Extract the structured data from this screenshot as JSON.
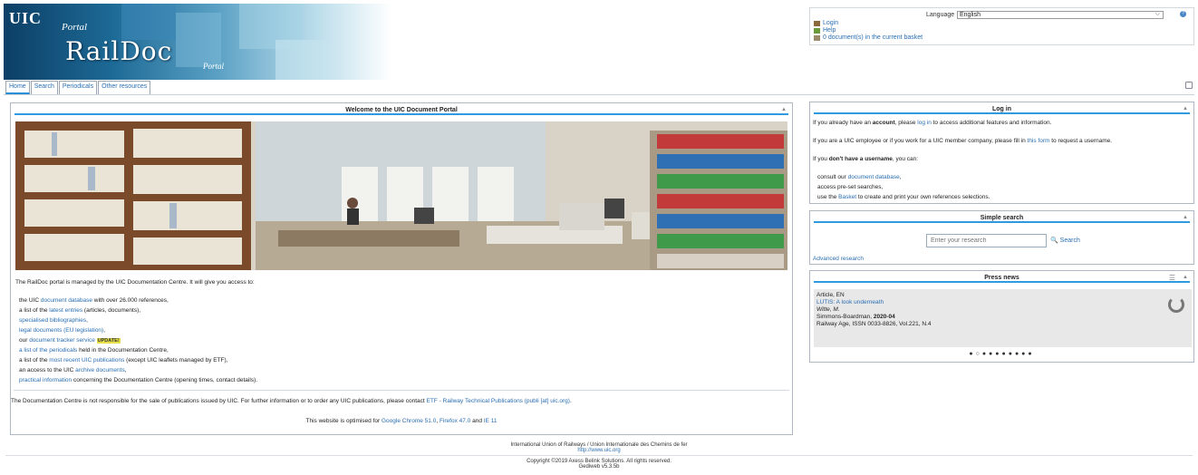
{
  "header": {
    "logo_uic": "UIC",
    "logo_portal": "Portal",
    "logo_raildoc": "RailDoc",
    "logo_portal2": "Portal"
  },
  "tabs": [
    {
      "label": "Home",
      "active": true
    },
    {
      "label": "Search"
    },
    {
      "label": "Periodicals"
    },
    {
      "label": "Other resources"
    }
  ],
  "topbox": {
    "language_label": "Language",
    "language_value": "English",
    "login": "Login",
    "help": "Help",
    "basket": "0 document(s) in the current basket"
  },
  "welcome": {
    "title": "Welcome to the UIC Document Portal",
    "intro": "The RailDoc portal is managed by the UIC Documentation Centre. It will give you access to:",
    "items": [
      {
        "pre": "the UIC ",
        "link": "document database",
        "post": " with over 26.000 references,"
      },
      {
        "pre": "a list of the ",
        "link": "latest entries",
        "post": " (articles, documents),"
      },
      {
        "pre": "",
        "link": "specialised bibliographies",
        "post": ","
      },
      {
        "pre": "",
        "link": "legal documents (EU legislation)",
        "post": ","
      },
      {
        "pre": "our ",
        "link": "document tracker service",
        "post": " ",
        "badge": "UPDATE!"
      },
      {
        "pre": "",
        "link": "a list of the periodicals",
        "post": " held in the Documentation Centre,"
      },
      {
        "pre": "a list of the ",
        "link": "most recent UIC publications",
        "post": " (except UIC leaflets managed by ETF),"
      },
      {
        "pre": "an access to the UIC ",
        "link": "archive documents",
        "post": ","
      },
      {
        "pre": "",
        "link": "practical information",
        "post": " concerning the Documentation Centre (opening times, contact details)."
      }
    ],
    "disclaimer_pre": "The Documentation Centre is not responsible for the sale of publications issued by UIC. For further information or to order any UIC publications, please contact ",
    "disclaimer_link": "ETF - Railway Technical Publications (publi [at] uic.org)",
    "disclaimer_post": ".",
    "optimised_pre": "This website is optimised for ",
    "browser1": "Google Chrome 51.0",
    "sep": ", ",
    "browser2": "Firefox 47.0",
    "and": " and ",
    "browser3": "IE 11"
  },
  "login_panel": {
    "title": "Log in",
    "p1_pre": "If you already have an ",
    "p1_bold": "account",
    "p1_mid": ", please ",
    "p1_link": "log in",
    "p1_post": " to access additional features and information.",
    "p2_pre": "If you are a UIC employee or if you work for a UIC member company, please fill in ",
    "p2_link": "this form",
    "p2_post": " to request a username.",
    "p3_pre": "If you ",
    "p3_bold": "don't have a username",
    "p3_post": ", you can:",
    "l1_pre": "consult our ",
    "l1_link": "document database",
    "l1_post": ",",
    "l2": "access pre-set searches,",
    "l3_pre": "use the ",
    "l3_link": "Basket",
    "l3_post": " to create and print your own references selections."
  },
  "simple_search": {
    "title": "Simple search",
    "placeholder": "Enter your research",
    "button": "Search",
    "advanced": "Advanced research"
  },
  "press": {
    "title": "Press news",
    "type": "Article, EN",
    "headline": "LUTIS: A look underneath",
    "author": "Witte, M.",
    "publisher_pre": "Simmons-Boardman, ",
    "publisher_date": "2020-04",
    "source": "Railway Age, ISSN 0033-8826, Vol.221, N.4",
    "dots": "●○●●●●●●●●"
  },
  "footer": {
    "line1": "International Union of Railways / Union Internationale des Chemins de fer",
    "line2": "http://www.uic.org",
    "line3": "Copyright ©2019 Axess Belink Solutions. All rights reserved.",
    "line4": "Gediweb v5.3.5b"
  }
}
